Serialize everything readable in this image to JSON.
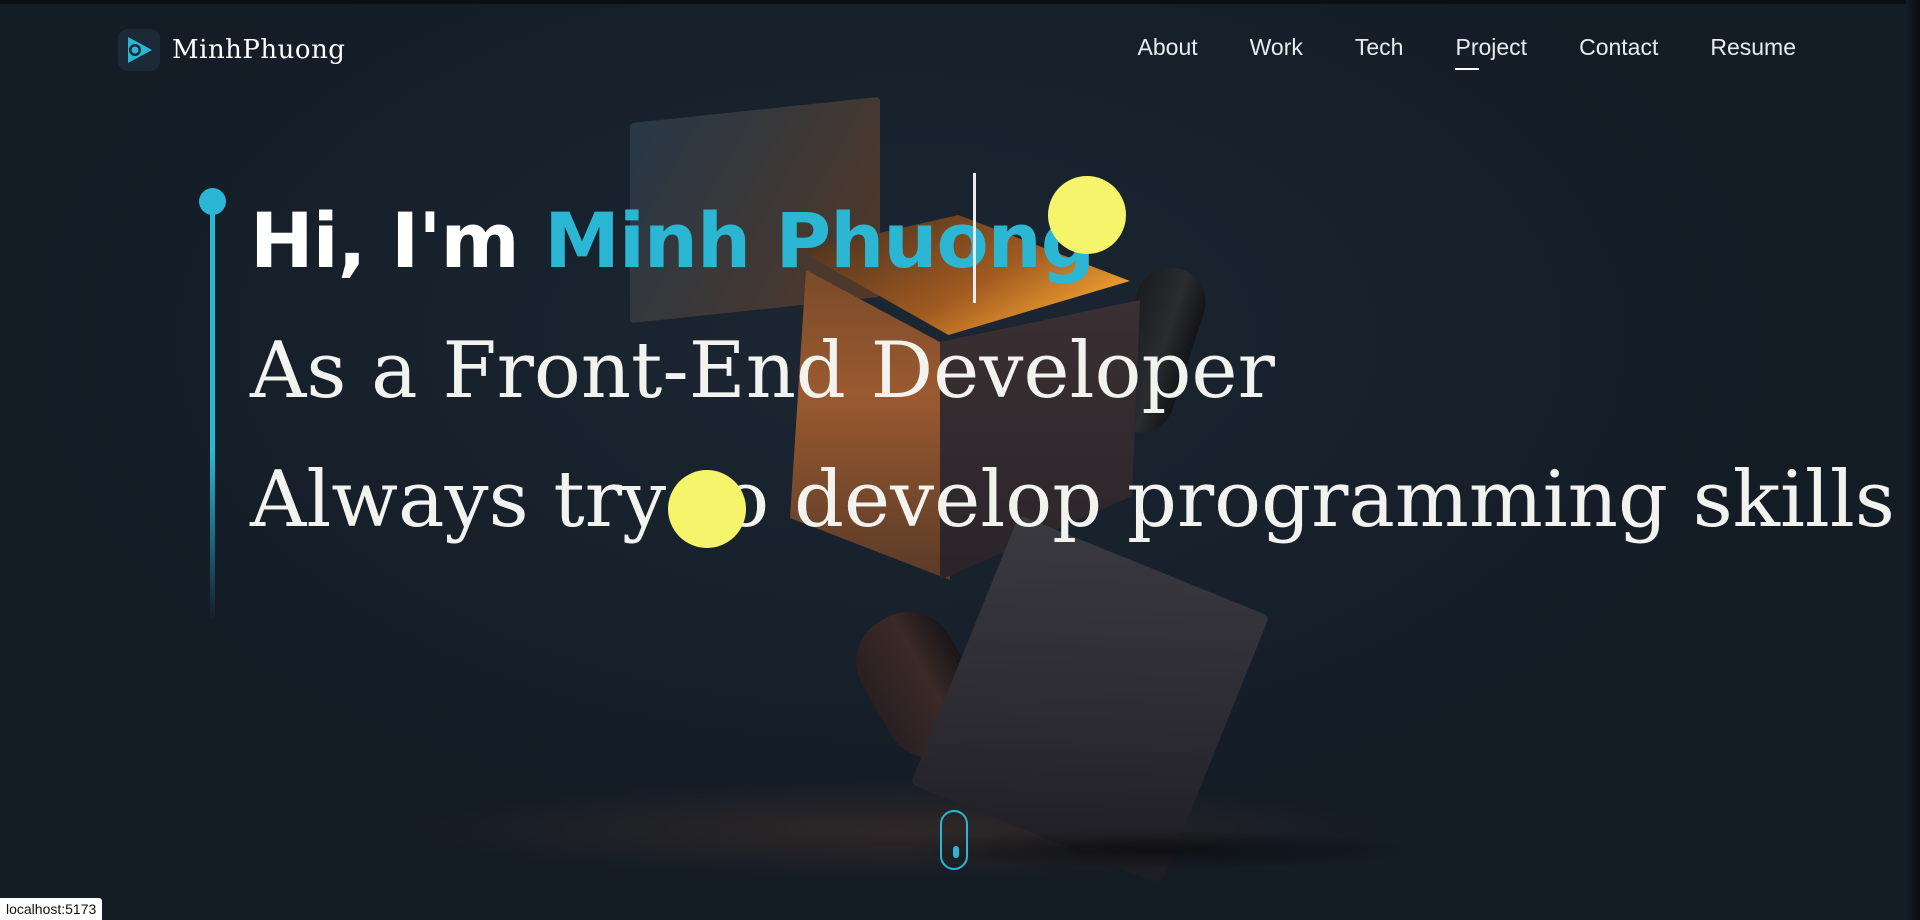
{
  "header": {
    "logo_text": "MinhPhuong",
    "nav": [
      {
        "label": "About",
        "active": false
      },
      {
        "label": "Work",
        "active": false
      },
      {
        "label": "Tech",
        "active": false
      },
      {
        "label": "Project",
        "active": true
      },
      {
        "label": "Contact",
        "active": false
      },
      {
        "label": "Resume",
        "active": false
      }
    ]
  },
  "hero": {
    "greeting": "Hi, I'm",
    "name": "Minh Phuong",
    "role": "As a Front-End Developer",
    "tagline": "Always try to develop programming skills"
  },
  "status_bar": {
    "url": "localhost:5173"
  },
  "colors": {
    "accent": "#2bb6d4",
    "highlight": "#f6f46a",
    "background": "#141c26"
  },
  "icons": {
    "logo": "play-logo-icon",
    "scroll": "mouse-scroll-icon"
  }
}
